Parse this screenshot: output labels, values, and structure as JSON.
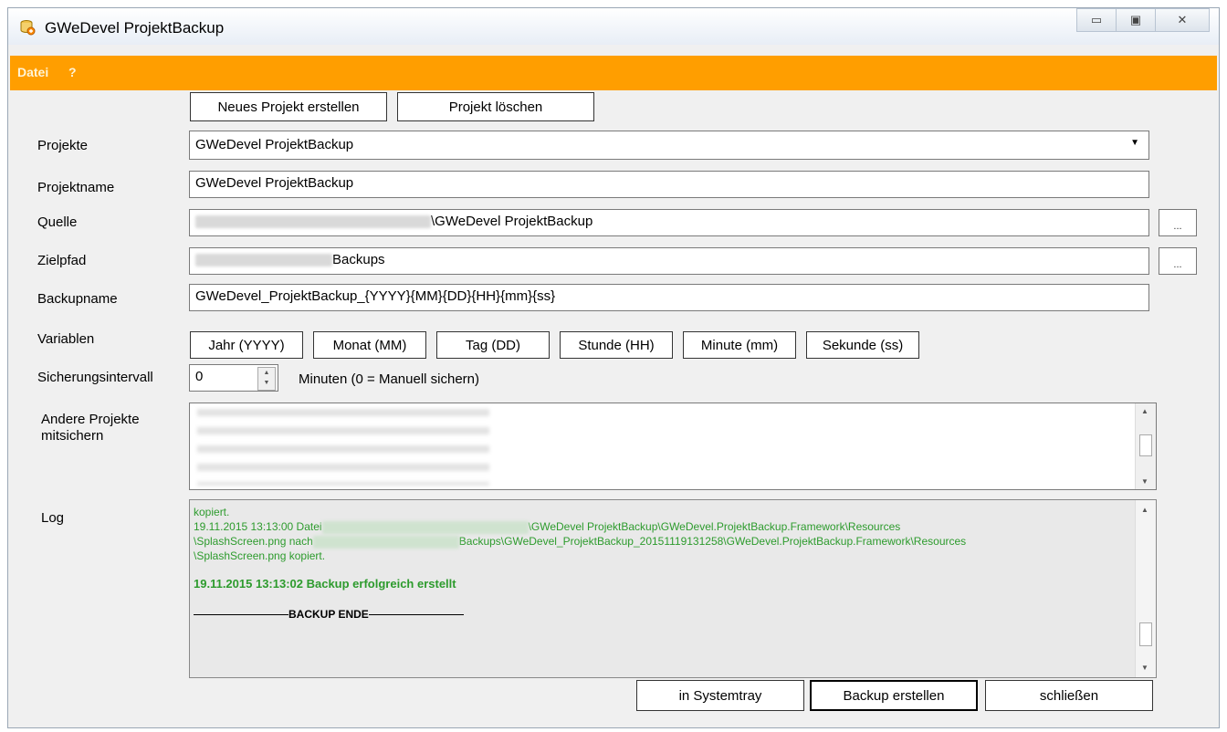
{
  "window": {
    "title": "GWeDevel ProjektBackup",
    "controls": {
      "minimize": "▭",
      "maximize": "▣",
      "close": "✕"
    }
  },
  "menu": {
    "file": "Datei",
    "help": "?"
  },
  "toolbar": {
    "new_project": "Neues Projekt erstellen",
    "delete_project": "Projekt löschen"
  },
  "form": {
    "projects_label": "Projekte",
    "projects_selected": "GWeDevel ProjektBackup",
    "projectname_label": "Projektname",
    "projectname_value": "GWeDevel ProjektBackup",
    "source_label": "Quelle",
    "source_value_suffix": "\\GWeDevel ProjektBackup",
    "target_label": "Zielpfad",
    "target_value_suffix": "Backups",
    "browse_label": "...",
    "backupname_label": "Backupname",
    "backupname_value": "GWeDevel_ProjektBackup_{YYYY}{MM}{DD}{HH}{mm}{ss}",
    "variables_label": "Variablen",
    "variables": [
      "Jahr (YYYY)",
      "Monat (MM)",
      "Tag (DD)",
      "Stunde (HH)",
      "Minute (mm)",
      "Sekunde (ss)"
    ],
    "interval_label": "Sicherungsintervall",
    "interval_value": "0",
    "interval_hint": "Minuten (0 = Manuell sichern)",
    "other_projects_label_line1": "Andere Projekte",
    "other_projects_label_line2": "mitsichern",
    "log_label": "Log"
  },
  "log": {
    "line1": "kopiert.",
    "line2_prefix": "19.11.2015 13:13:00 Datei",
    "line2_suffix": "\\GWeDevel ProjektBackup\\GWeDevel.ProjektBackup.Framework\\Resources",
    "line3_prefix": "\\SplashScreen.png nach",
    "line3_suffix": "Backups\\GWeDevel_ProjektBackup_20151119131258\\GWeDevel.ProjektBackup.Framework\\Resources",
    "line4": "\\SplashScreen.png kopiert.",
    "success": "19.11.2015 13:13:02 Backup erfolgreich erstellt",
    "end_marker": "BACKUP ENDE"
  },
  "footer": {
    "tray": "in Systemtray",
    "create_backup": "Backup erstellen",
    "close": "schließen"
  },
  "colors": {
    "menubar": "#ff9e00",
    "log_text": "#2d9b2d"
  }
}
